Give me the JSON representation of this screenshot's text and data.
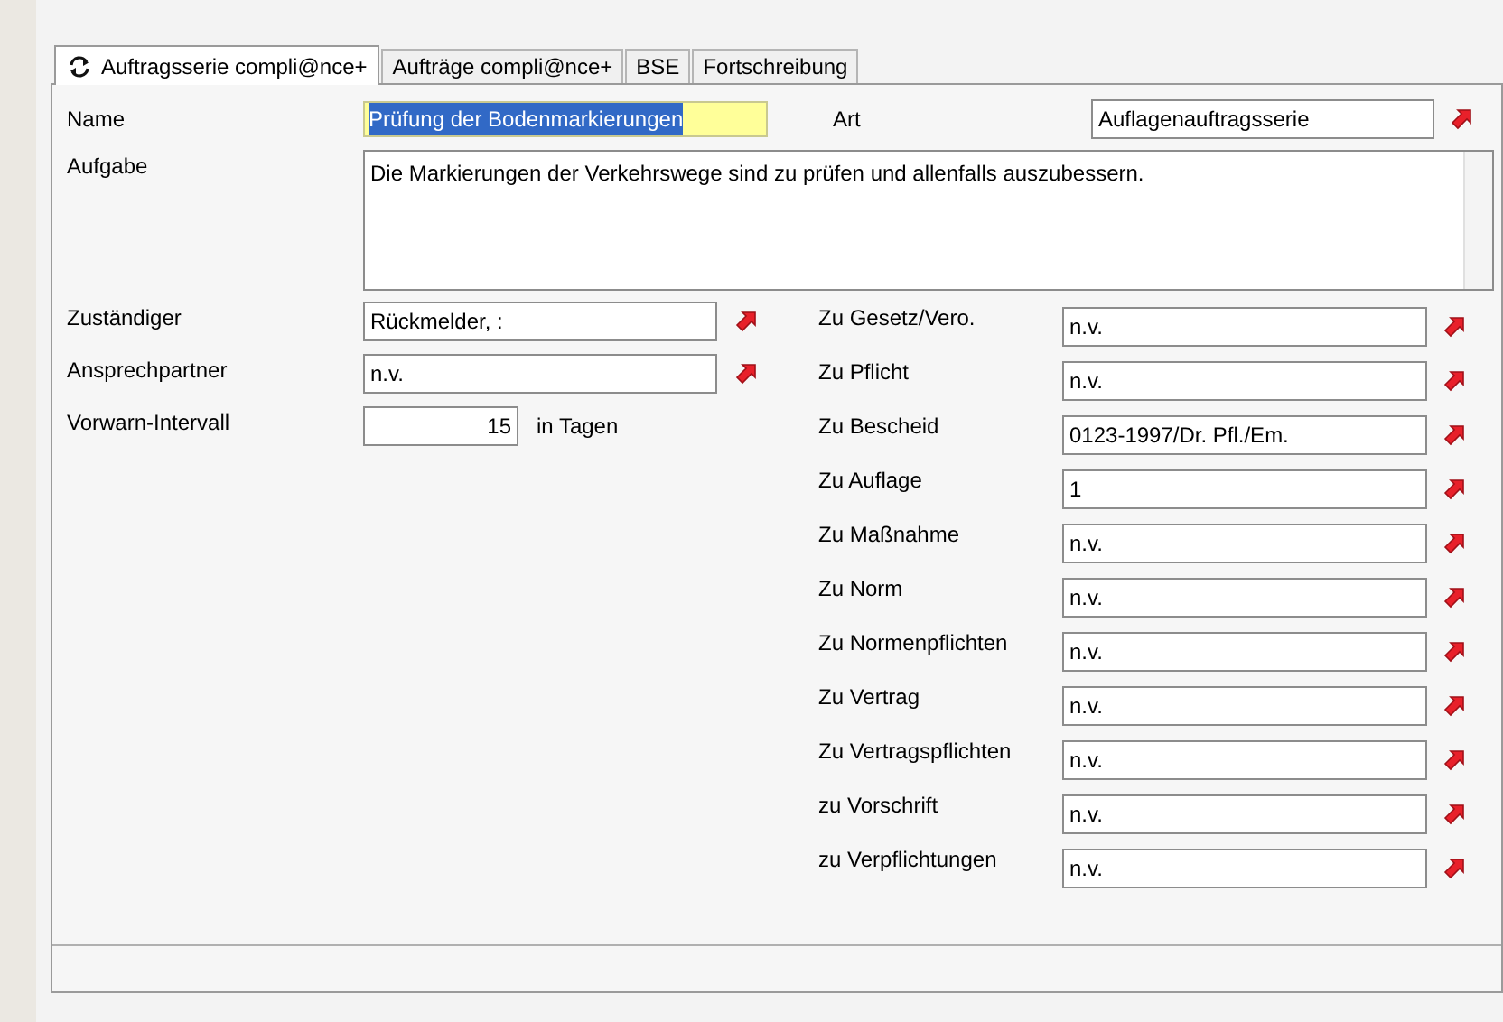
{
  "tabs": [
    {
      "label": "Auftragsserie compli@nce+",
      "selected": true
    },
    {
      "label": "Aufträge compli@nce+",
      "selected": false
    },
    {
      "label": "BSE",
      "selected": false
    },
    {
      "label": "Fortschreibung",
      "selected": false
    }
  ],
  "name": {
    "label": "Name",
    "value": "Prüfung der Bodenmarkierungen",
    "text_selected": true
  },
  "art": {
    "label": "Art",
    "value": "Auflagenauftragsserie"
  },
  "aufgabe": {
    "label": "Aufgabe",
    "value": "Die Markierungen der Verkehrswege sind zu prüfen und allenfalls auszubessern."
  },
  "left_fields": [
    {
      "label": "Zuständiger",
      "value": "Rückmelder, :",
      "kind": "lookup"
    },
    {
      "label": "Ansprechpartner",
      "value": "n.v.",
      "kind": "lookup"
    },
    {
      "label": "Vorwarn-Intervall",
      "value": "15",
      "unit": "in Tagen",
      "kind": "number"
    }
  ],
  "right_fields": [
    {
      "label": "Zu Gesetz/Vero.",
      "value": "n.v."
    },
    {
      "label": "Zu Pflicht",
      "value": "n.v."
    },
    {
      "label": "Zu Bescheid",
      "value": "0123-1997/Dr. Pfl./Em."
    },
    {
      "label": "Zu Auflage",
      "value": "1"
    },
    {
      "label": "Zu Maßnahme",
      "value": "n.v."
    },
    {
      "label": "Zu Norm",
      "value": "n.v."
    },
    {
      "label": "Zu Normenpflichten",
      "value": "n.v."
    },
    {
      "label": "Zu Vertrag",
      "value": "n.v."
    },
    {
      "label": "Zu Vertragspflichten",
      "value": "n.v."
    },
    {
      "label": "zu Vorschrift",
      "value": "n.v."
    },
    {
      "label": "zu Verpflichtungen",
      "value": "n.v."
    }
  ]
}
